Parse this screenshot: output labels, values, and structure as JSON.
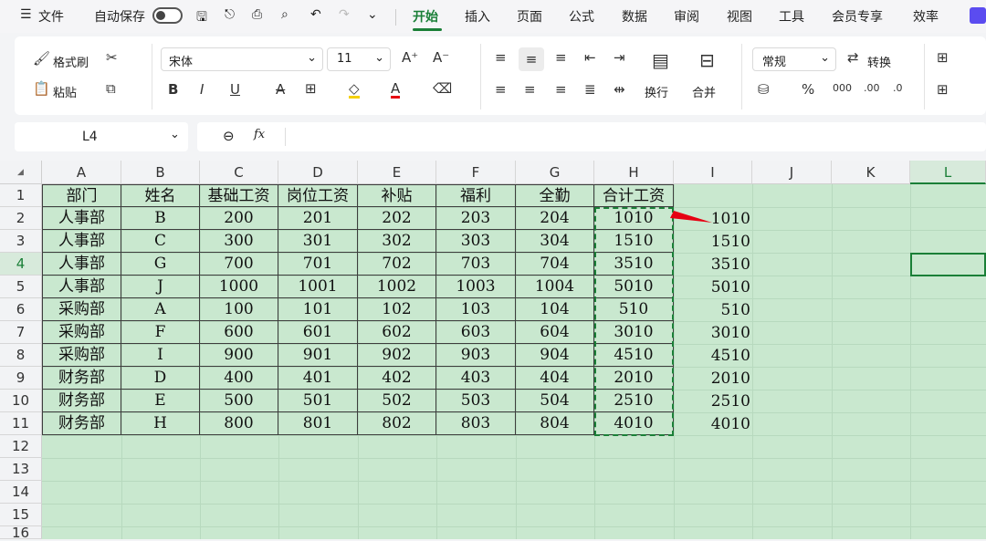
{
  "menubar": {
    "menu_icon": "☰",
    "file": "文件",
    "autosave": "自动保存",
    "tabs": [
      "开始",
      "插入",
      "页面",
      "公式",
      "数据",
      "审阅",
      "视图",
      "工具",
      "会员专享",
      "效率"
    ]
  },
  "ribbon": {
    "format_painter": "格式刷",
    "paste": "粘贴",
    "font_name": "宋体",
    "font_size": "11",
    "wrap": "换行",
    "merge": "合并",
    "number_format": "常规",
    "convert": "转换"
  },
  "formula_bar": {
    "cell_ref": "L4",
    "fx": "fx"
  },
  "sheet": {
    "columns": [
      "A",
      "B",
      "C",
      "D",
      "E",
      "F",
      "G",
      "H",
      "I",
      "J",
      "K",
      "L"
    ],
    "rows": [
      "1",
      "2",
      "3",
      "4",
      "5",
      "6",
      "7",
      "8",
      "9",
      "10",
      "11",
      "12",
      "13",
      "14",
      "15",
      "16"
    ],
    "headers": [
      "部门",
      "姓名",
      "基础工资",
      "岗位工资",
      "补贴",
      "福利",
      "全勤",
      "合计工资"
    ],
    "data": [
      [
        "人事部",
        "B",
        "200",
        "201",
        "202",
        "203",
        "204",
        "1010"
      ],
      [
        "人事部",
        "C",
        "300",
        "301",
        "302",
        "303",
        "304",
        "1510"
      ],
      [
        "人事部",
        "G",
        "700",
        "701",
        "702",
        "703",
        "704",
        "3510"
      ],
      [
        "人事部",
        "J",
        "1000",
        "1001",
        "1002",
        "1003",
        "1004",
        "5010"
      ],
      [
        "采购部",
        "A",
        "100",
        "101",
        "102",
        "103",
        "104",
        "510"
      ],
      [
        "采购部",
        "F",
        "600",
        "601",
        "602",
        "603",
        "604",
        "3010"
      ],
      [
        "采购部",
        "I",
        "900",
        "901",
        "902",
        "903",
        "904",
        "4510"
      ],
      [
        "财务部",
        "D",
        "400",
        "401",
        "402",
        "403",
        "404",
        "2010"
      ],
      [
        "财务部",
        "E",
        "500",
        "501",
        "502",
        "503",
        "504",
        "2510"
      ],
      [
        "财务部",
        "H",
        "800",
        "801",
        "802",
        "803",
        "804",
        "4010"
      ]
    ],
    "col_i": [
      "1010",
      "1510",
      "3510",
      "5010",
      "510",
      "3010",
      "4510",
      "2010",
      "2510",
      "4010"
    ],
    "selected_cell": "L4",
    "copy_range": "H2:H11"
  },
  "colors": {
    "accent": "#1a7f37",
    "grid_bg": "#c9e8cf",
    "arrow": "#e60012"
  }
}
